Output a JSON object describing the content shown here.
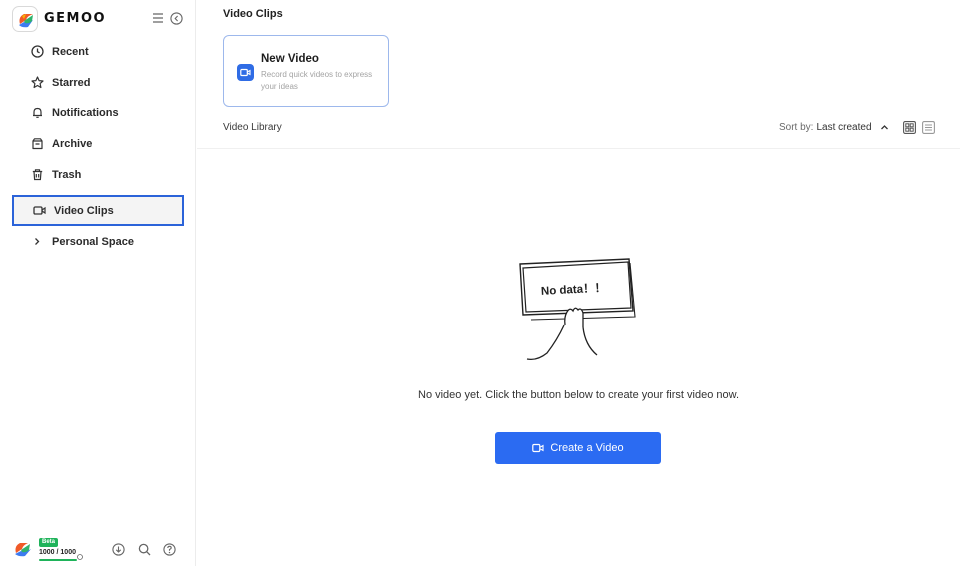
{
  "app": {
    "brand_name": "GEMOO"
  },
  "sidebar": {
    "items": [
      {
        "label": "Recent",
        "icon": "clock-icon"
      },
      {
        "label": "Starred",
        "icon": "star-icon"
      },
      {
        "label": "Notifications",
        "icon": "bell-icon"
      },
      {
        "label": "Archive",
        "icon": "archive-icon"
      },
      {
        "label": "Trash",
        "icon": "trash-icon"
      },
      {
        "label": "Video Clips",
        "icon": "video-camera-icon",
        "active": true
      },
      {
        "label": "Personal Space",
        "icon": "chevron-right-icon"
      }
    ],
    "footer": {
      "badge": "Beta",
      "quota": "1000 / 1000",
      "quota_fill": 1.0
    }
  },
  "main": {
    "title": "Video Clips",
    "new_card": {
      "title": "New Video",
      "description": "Record quick videos to express your ideas"
    },
    "library_label": "Video Library",
    "sort": {
      "prefix": "Sort by:",
      "value": "Last created"
    },
    "empty": {
      "illustration_text": "No data！！",
      "message": "No video yet. Click the button below to create your first video now."
    },
    "create_button": "Create a Video"
  },
  "colors": {
    "accent": "#2b6bf2",
    "active_border": "#2b63d9",
    "quota_green": "#1fb35a"
  }
}
